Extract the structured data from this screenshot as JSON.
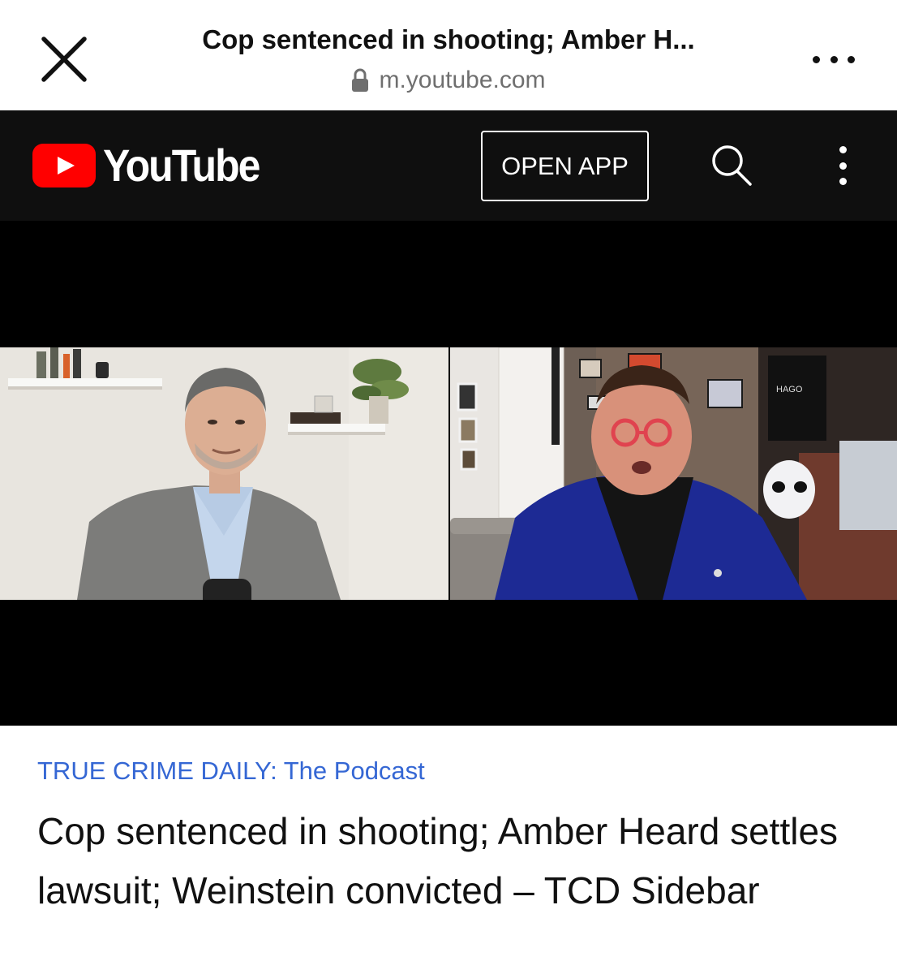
{
  "browser": {
    "page_title": "Cop sentenced in shooting; Amber H...",
    "url": "m.youtube.com",
    "icons": {
      "close": "close-icon",
      "lock": "lock-icon",
      "more": "more-horizontal-icon"
    }
  },
  "youtube_header": {
    "logo_text": "YouTube",
    "open_app_label": "OPEN APP",
    "icons": {
      "logo": "youtube-play-icon",
      "search": "search-icon",
      "menu": "more-vertical-icon"
    },
    "colors": {
      "background": "#0f0f0f",
      "logo_red": "#ff0000"
    }
  },
  "video": {
    "channel": "TRUE CRIME DAILY: The Podcast",
    "title": "Cop sentenced in shooting; Amber Heard settles lawsuit; Weinstein convicted – TCD Sidebar"
  },
  "colors": {
    "channel_link": "#3567d4",
    "title_text": "#111111"
  }
}
